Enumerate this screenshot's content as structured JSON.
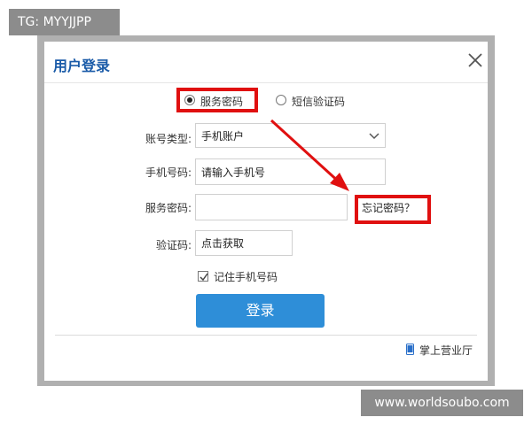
{
  "watermarks": {
    "top": "TG: MYYJJPP",
    "bottom": "www.worldsoubo.com"
  },
  "dialog": {
    "title": "用户登录",
    "modes": [
      {
        "label": "服务密码",
        "selected": true
      },
      {
        "label": "短信验证码",
        "selected": false
      }
    ],
    "account_type": {
      "label": "账号类型:",
      "value": "手机账户"
    },
    "phone": {
      "label": "手机号码:",
      "placeholder": "请输入手机号"
    },
    "password": {
      "label": "服务密码:",
      "value": ""
    },
    "forgot_link": "忘记密码？",
    "captcha": {
      "label": "验证码:",
      "button": "点击获取"
    },
    "remember": {
      "label": "记住手机号码",
      "checked": true
    },
    "login_button": "登录",
    "hall_link": "掌上营业厅"
  },
  "colors": {
    "accent": "#2e8ed8",
    "title": "#1a5ba8",
    "highlight": "#e01010"
  },
  "icons": [
    "close-icon",
    "chevron-down-icon",
    "check-icon",
    "phone-icon",
    "arrow-annotation"
  ]
}
